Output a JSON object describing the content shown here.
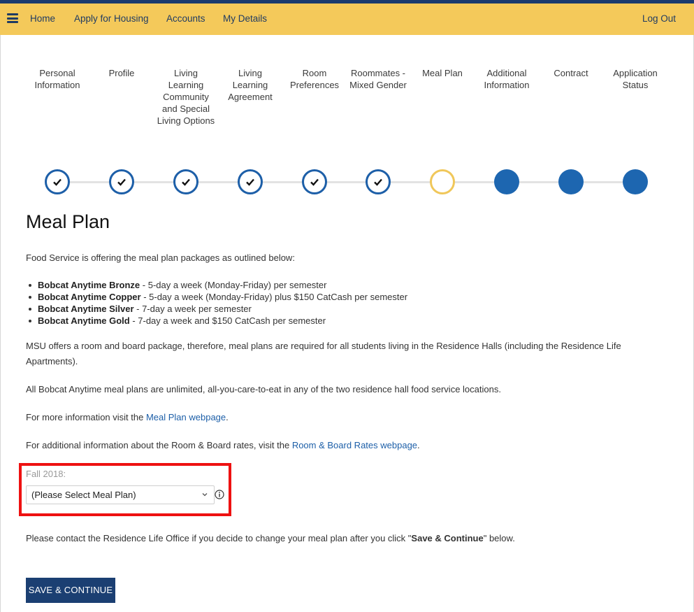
{
  "nav": {
    "links": [
      "Home",
      "Apply for Housing",
      "Accounts",
      "My Details"
    ],
    "logout": "Log Out"
  },
  "steps": [
    {
      "label": "Personal Information",
      "status": "done"
    },
    {
      "label": "Profile",
      "status": "done"
    },
    {
      "label": "Living Learning Community and Special Living Options",
      "status": "done"
    },
    {
      "label": "Living Learning Agreement",
      "status": "done"
    },
    {
      "label": "Room Preferences",
      "status": "done"
    },
    {
      "label": "Roommates - Mixed Gender",
      "status": "done"
    },
    {
      "label": "Meal Plan",
      "status": "current"
    },
    {
      "label": "Additional Information",
      "status": "todo"
    },
    {
      "label": "Contract",
      "status": "todo"
    },
    {
      "label": "Application Status",
      "status": "todo"
    }
  ],
  "main": {
    "title": "Meal Plan",
    "intro": "Food Service is offering the meal plan packages as outlined below:",
    "plans": [
      {
        "name": "Bobcat Anytime Bronze",
        "desc": " - 5-day a week (Monday-Friday) per semester"
      },
      {
        "name": "Bobcat Anytime Copper",
        "desc": " - 5-day a week (Monday-Friday) plus $150 CatCash per semester"
      },
      {
        "name": "Bobcat Anytime Silver",
        "desc": " - 7-day a week per semester"
      },
      {
        "name": "Bobcat Anytime Gold",
        "desc": " - 7-day a week and $150 CatCash per semester"
      }
    ],
    "package_text": "MSU offers a room and board package, therefore, meal plans are required for all students living in the Residence Halls (including the Residence Life Apartments).",
    "unlimited_text": "All Bobcat Anytime meal plans are unlimited, all-you-care-to-eat in any of the two residence hall food service locations.",
    "more_info_prefix": "For more information visit the ",
    "more_info_link": "Meal Plan webpage",
    "more_info_suffix": ".",
    "rates_prefix": "For additional information about the Room & Board rates, visit the ",
    "rates_link": "Room & Board Rates webpage",
    "rates_suffix": ".",
    "term_label": "Fall 2018:",
    "select_value": "(Please Select Meal Plan)",
    "contact_prefix": "Please contact the Residence Life Office if you decide to change your meal plan after you click \"",
    "contact_bold": "Save & Continue",
    "contact_suffix": "\" below.",
    "save_button": "SAVE & CONTINUE"
  },
  "colors": {
    "nav_bg": "#f4c95a",
    "brand_navy": "#1b3f72",
    "step_blue": "#1d66b0",
    "step_current": "#f0c75a",
    "link": "#1d5fa8",
    "highlight": "#ee1111"
  },
  "icons": {
    "menu": "hamburger-icon",
    "done": "check-icon",
    "select": "chevron-down-icon",
    "info": "info-icon"
  }
}
